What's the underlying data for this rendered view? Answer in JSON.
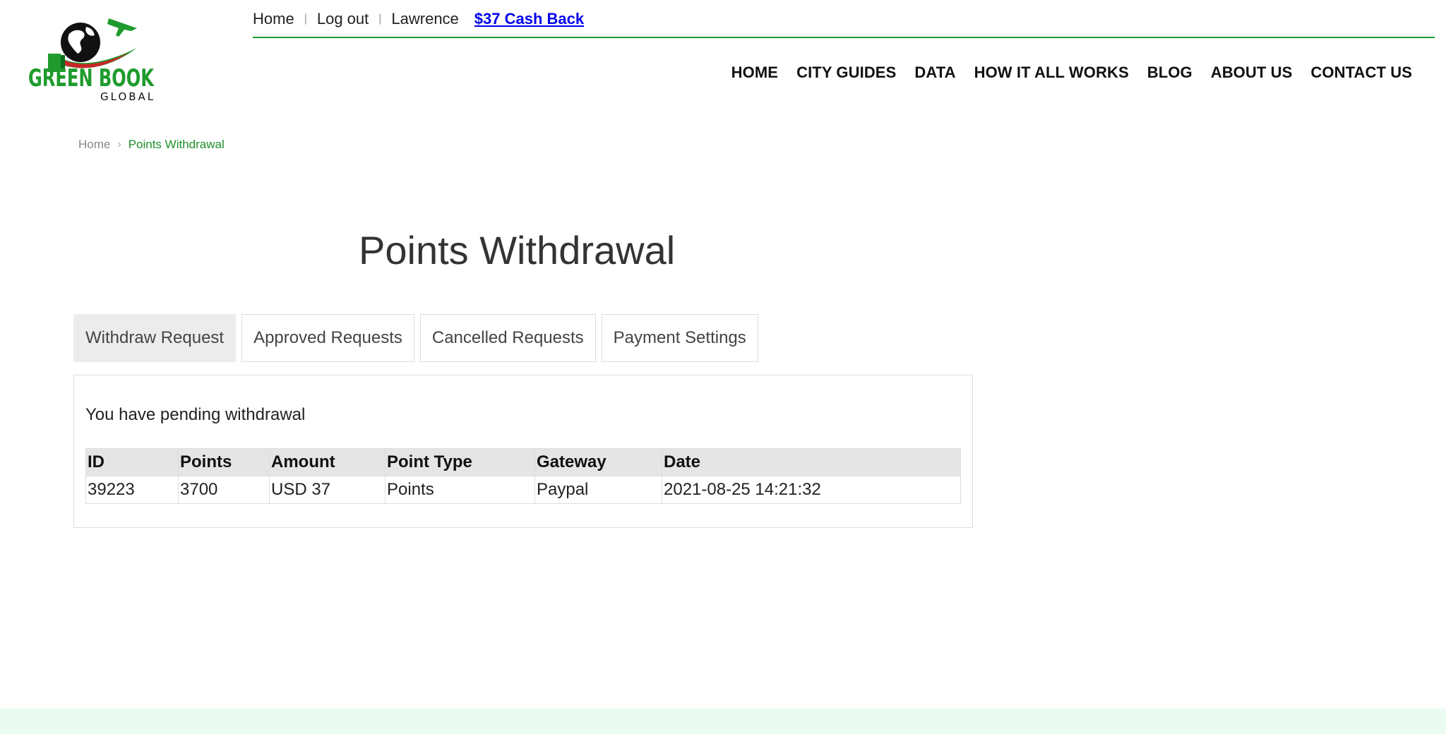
{
  "brand": {
    "name_line1": "GREEN BOOK",
    "name_line2": "GLOBAL",
    "green": "#1e9b2c"
  },
  "topbar": {
    "home": "Home",
    "logout": "Log out",
    "user": "Lawrence",
    "cashback": "$37 Cash Back",
    "separator": "|"
  },
  "nav": [
    "HOME",
    "CITY GUIDES",
    "DATA",
    "HOW IT ALL WORKS",
    "BLOG",
    "ABOUT US",
    "CONTACT US"
  ],
  "breadcrumb": {
    "home": "Home",
    "current": "Points Withdrawal",
    "separator": "›"
  },
  "page": {
    "title": "Points Withdrawal"
  },
  "tabs": [
    {
      "label": "Withdraw Request",
      "active": true
    },
    {
      "label": "Approved Requests",
      "active": false
    },
    {
      "label": "Cancelled Requests",
      "active": false
    },
    {
      "label": "Payment Settings",
      "active": false
    }
  ],
  "panel": {
    "pending_message": "You have pending withdrawal",
    "table": {
      "headers": [
        "ID",
        "Points",
        "Amount",
        "Point Type",
        "Gateway",
        "Date"
      ],
      "rows": [
        [
          "39223",
          "3700",
          "USD 37",
          "Points",
          "Paypal",
          "2021-08-25 14:21:32"
        ]
      ]
    }
  }
}
